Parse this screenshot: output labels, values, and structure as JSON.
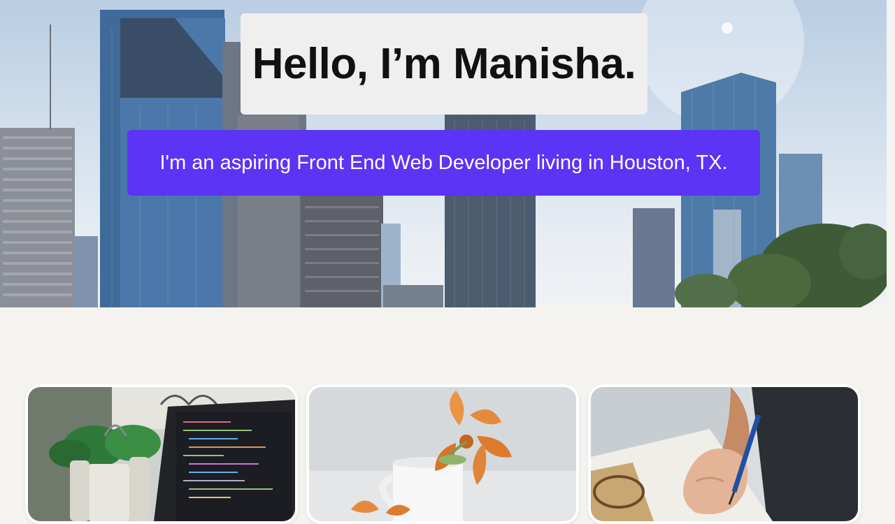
{
  "hero": {
    "title": "Hello, I’m Manisha.",
    "subtitle": "I'm an aspiring Front End Web Developer living in Houston, TX.",
    "background_image": "houston-skyline-photo"
  },
  "colors": {
    "page_background": "#f4f3ef",
    "title_box": "#efefef",
    "subtitle_box": "#5b34f5",
    "subtitle_text": "#ffffff",
    "title_text": "#111111"
  },
  "cards": [
    {
      "image": "laptop-with-plants-photo"
    },
    {
      "image": "orange-lily-and-white-cup-photo"
    },
    {
      "image": "hand-writing-in-notebook-photo"
    }
  ]
}
